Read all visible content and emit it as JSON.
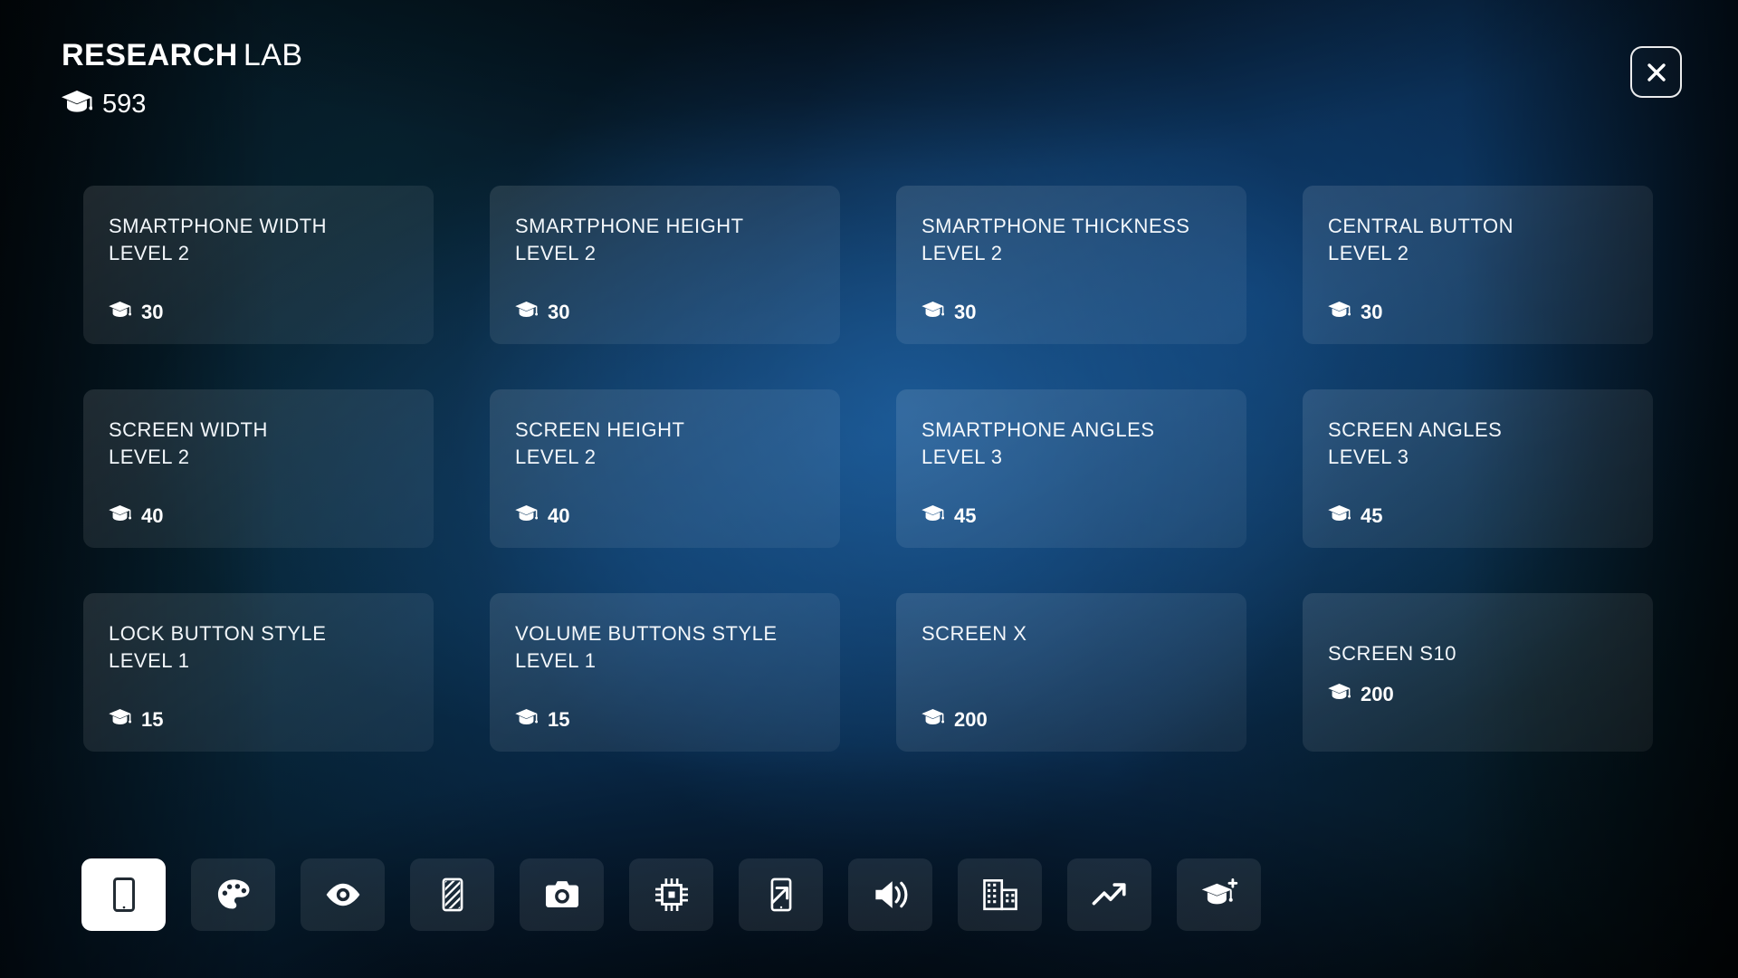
{
  "header": {
    "title_strong": "RESEARCH",
    "title_light": "LAB",
    "points_icon": "graduation-cap-icon",
    "points_value": "593",
    "close_label": "×"
  },
  "cards": [
    {
      "name": "SMARTPHONE WIDTH",
      "level": "LEVEL 2",
      "cost": "30",
      "cost_icon": "graduation-cap-icon"
    },
    {
      "name": "SMARTPHONE HEIGHT",
      "level": "LEVEL 2",
      "cost": "30",
      "cost_icon": "graduation-cap-icon"
    },
    {
      "name": "SMARTPHONE THICKNESS",
      "level": "LEVEL 2",
      "cost": "30",
      "cost_icon": "graduation-cap-icon"
    },
    {
      "name": "CENTRAL BUTTON",
      "level": "LEVEL 2",
      "cost": "30",
      "cost_icon": "graduation-cap-icon"
    },
    {
      "name": "SCREEN WIDTH",
      "level": "LEVEL 2",
      "cost": "40",
      "cost_icon": "graduation-cap-icon"
    },
    {
      "name": "SCREEN HEIGHT",
      "level": "LEVEL 2",
      "cost": "40",
      "cost_icon": "graduation-cap-icon"
    },
    {
      "name": "SMARTPHONE ANGLES",
      "level": "LEVEL 3",
      "cost": "45",
      "cost_icon": "graduation-cap-icon"
    },
    {
      "name": "SCREEN ANGLES",
      "level": "LEVEL 3",
      "cost": "45",
      "cost_icon": "graduation-cap-icon"
    },
    {
      "name": "LOCK BUTTON STYLE",
      "level": "LEVEL 1",
      "cost": "15",
      "cost_icon": "graduation-cap-icon"
    },
    {
      "name": "VOLUME BUTTONS STYLE",
      "level": "LEVEL 1",
      "cost": "15",
      "cost_icon": "graduation-cap-icon"
    },
    {
      "name": "SCREEN X",
      "level": "",
      "cost": "200",
      "cost_icon": "graduation-cap-icon"
    },
    {
      "name": "SCREEN S10",
      "level": "",
      "cost": "200",
      "cost_icon": "graduation-cap-icon"
    }
  ],
  "toolbar": [
    {
      "icon": "smartphone-icon",
      "label": "Smartphone",
      "active": true
    },
    {
      "icon": "palette-icon",
      "label": "Design",
      "active": false
    },
    {
      "icon": "eye-icon",
      "label": "Display",
      "active": false
    },
    {
      "icon": "phone-texture-icon",
      "label": "Materials",
      "active": false
    },
    {
      "icon": "camera-icon",
      "label": "Camera",
      "active": false
    },
    {
      "icon": "cpu-chip-icon",
      "label": "Processor",
      "active": false
    },
    {
      "icon": "phone-share-icon",
      "label": "Export",
      "active": false
    },
    {
      "icon": "speaker-volume-icon",
      "label": "Sound",
      "active": false
    },
    {
      "icon": "office-building-icon",
      "label": "Company",
      "active": false
    },
    {
      "icon": "trending-up-icon",
      "label": "Marketing",
      "active": false
    },
    {
      "icon": "graduation-cap-plus-icon",
      "label": "Research Lab",
      "active": false
    }
  ],
  "colors": {
    "accent": "#2d78c3",
    "card_bg": "rgba(255,255,255,0.10)",
    "text": "#f3f7fb",
    "active_bg": "#ffffff"
  }
}
